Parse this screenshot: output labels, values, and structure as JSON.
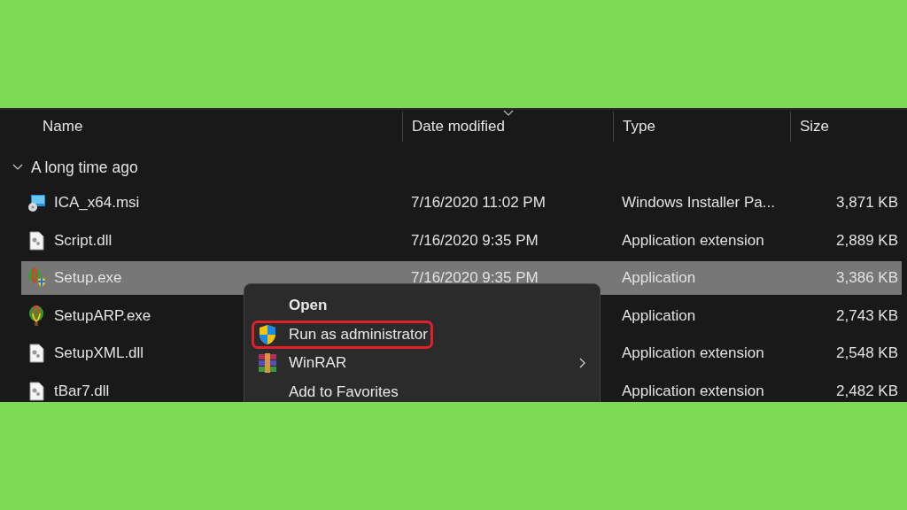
{
  "columns": [
    {
      "label": "Name",
      "sorted": false
    },
    {
      "label": "Date modified",
      "sorted": true
    },
    {
      "label": "Type",
      "sorted": false
    },
    {
      "label": "Size",
      "sorted": false
    }
  ],
  "group": {
    "label": "A long time ago",
    "expanded": true
  },
  "files": [
    {
      "name": "ICA_x64.msi",
      "kind": "installer",
      "date": "7/16/2020 11:02 PM",
      "type": "Windows Installer Pa...",
      "size": "3,871 KB",
      "selected": false
    },
    {
      "name": "Script.dll",
      "kind": "dll",
      "date": "7/16/2020 9:35 PM",
      "type": "Application extension",
      "size": "2,889 KB",
      "selected": false
    },
    {
      "name": "Setup.exe",
      "kind": "setup",
      "date": "7/16/2020 9:35 PM",
      "type": "Application",
      "size": "3,386 KB",
      "selected": true
    },
    {
      "name": "SetupARP.exe",
      "kind": "app",
      "type": "Application",
      "size": "2,743 KB",
      "selected": false
    },
    {
      "name": "SetupXML.dll",
      "kind": "dll",
      "type": "Application extension",
      "size": "2,548 KB",
      "selected": false
    },
    {
      "name": "tBar7.dll",
      "kind": "dll",
      "type": "Application extension",
      "size": "2,482 KB",
      "selected": false
    }
  ],
  "context_menu": [
    {
      "label": "Open",
      "kind": "plain",
      "default": true,
      "submenu": false,
      "highlighted": false
    },
    {
      "label": "Run as administrator",
      "kind": "shield",
      "default": false,
      "submenu": false,
      "highlighted": true
    },
    {
      "label": "WinRAR",
      "kind": "archive",
      "default": false,
      "submenu": true,
      "highlighted": false
    },
    {
      "label": "Add to Favorites",
      "kind": "plain",
      "default": false,
      "submenu": false,
      "highlighted": false
    }
  ]
}
